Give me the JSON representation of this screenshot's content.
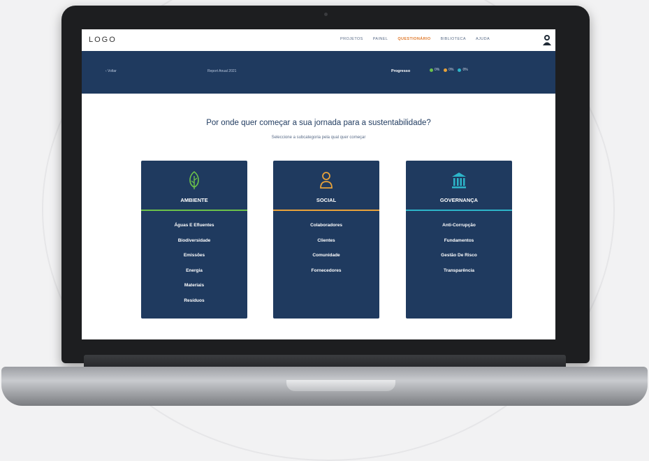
{
  "topnav": {
    "logo": "LOGO",
    "items": [
      {
        "label": "PROJETOS",
        "active": false
      },
      {
        "label": "PAINEL",
        "active": false
      },
      {
        "label": "QUESTIONÁRIO",
        "active": true
      },
      {
        "label": "BIBLIOTECA",
        "active": false
      },
      {
        "label": "AJUDA",
        "active": false
      }
    ],
    "avatar_icon": "user-avatar-icon"
  },
  "bluebar": {
    "back_link": "‹ Voltar",
    "report": "Report Anual 2021",
    "progress_label": "Progresso",
    "progress": [
      {
        "icon": "leaf-icon",
        "value": "0%",
        "color": "#6cc24a"
      },
      {
        "icon": "person-icon",
        "value": "0%",
        "color": "#e8a23a"
      },
      {
        "icon": "building-icon",
        "value": "0%",
        "color": "#2db5c9"
      }
    ]
  },
  "main": {
    "headline": "Por onde quer começar a sua jornada para a sustentabilidade?",
    "subline": "Seleccione a subcategoria pela qual quer começar"
  },
  "cards": [
    {
      "title": "AMBIENTE",
      "icon": "leaf-icon",
      "accent": "#6cc24a",
      "items": [
        "Águas E Efluentes",
        "Biodiversidade",
        "Emissões",
        "Energia",
        "Materiais",
        "Resíduos"
      ]
    },
    {
      "title": "SOCIAL",
      "icon": "person-icon",
      "accent": "#e8a23a",
      "items": [
        "Colaboradores",
        "Clientes",
        "Comunidade",
        "Fornecedores"
      ]
    },
    {
      "title": "GOVERNANÇA",
      "icon": "building-icon",
      "accent": "#2db5c9",
      "items": [
        "Anti-Corrupção",
        "Fundamentos",
        "Gestão De Risco",
        "Transparência"
      ]
    }
  ]
}
